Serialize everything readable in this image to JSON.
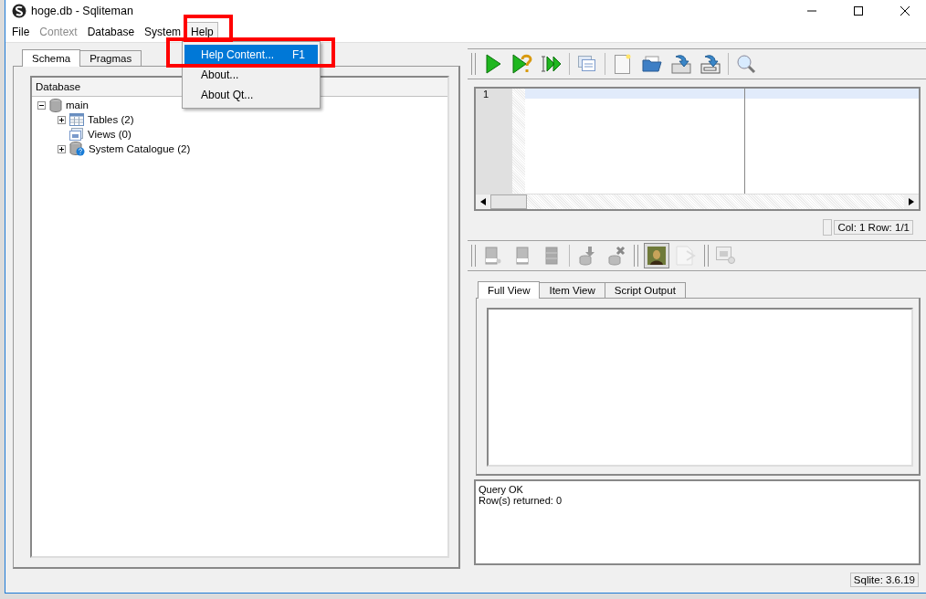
{
  "window": {
    "title": "hoge.db - Sqliteman"
  },
  "menu": [
    {
      "label": "File",
      "disabled": false,
      "open": false
    },
    {
      "label": "Context",
      "disabled": true,
      "open": false
    },
    {
      "label": "Database",
      "disabled": false,
      "open": false
    },
    {
      "label": "System",
      "disabled": false,
      "open": false
    },
    {
      "label": "Help",
      "disabled": false,
      "open": true
    }
  ],
  "help_menu": [
    {
      "label": "Help Content...",
      "shortcut": "F1",
      "selected": true
    },
    {
      "label": "About...",
      "selected": false
    },
    {
      "label": "About Qt...",
      "selected": false
    }
  ],
  "left_tabs": [
    {
      "label": "Schema",
      "selected": true
    },
    {
      "label": "Pragmas",
      "selected": false
    }
  ],
  "tree": {
    "header": "Database",
    "items": [
      {
        "label": "main",
        "kind": "database",
        "expanded": true,
        "children": [
          {
            "label": "Tables (2)",
            "kind": "tables",
            "expanded": false
          },
          {
            "label": "Views (0)",
            "kind": "views"
          },
          {
            "label": "System Catalogue (2)",
            "kind": "catalogue",
            "expanded": false
          }
        ]
      }
    ]
  },
  "editor": {
    "line_numbers": [
      "1"
    ]
  },
  "cursor_status": "Col: 1 Row: 1/1",
  "result_tabs": [
    {
      "label": "Full View",
      "selected": true
    },
    {
      "label": "Item View",
      "selected": false
    },
    {
      "label": "Script Output",
      "selected": false
    }
  ],
  "log": [
    "Query OK",
    "Row(s) returned: 0"
  ],
  "status_bar": "Sqlite: 3.6.19"
}
